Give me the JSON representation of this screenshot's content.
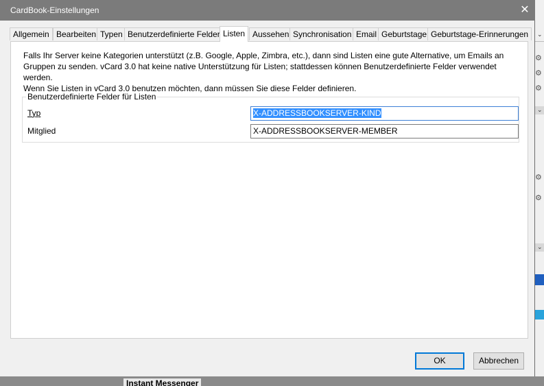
{
  "dialog": {
    "title": "CardBook-Einstellungen",
    "close_symbol": "✕"
  },
  "tabs": [
    {
      "label": "Allgemein",
      "active": false
    },
    {
      "label": "Bearbeiten",
      "active": false
    },
    {
      "label": "Typen",
      "active": false
    },
    {
      "label": "Benutzerdefinierte Felder",
      "active": false
    },
    {
      "label": "Listen",
      "active": true
    },
    {
      "label": "Aussehen",
      "active": false
    },
    {
      "label": "Synchronisation",
      "active": false
    },
    {
      "label": "Email",
      "active": false
    },
    {
      "label": "Geburtstage",
      "active": false
    },
    {
      "label": "Geburtstage-Erinnerungen",
      "active": false
    }
  ],
  "panel": {
    "description_line1": "Falls Ihr Server keine Kategorien unterstützt (z.B. Google, Apple, Zimbra, etc.), dann sind Listen eine gute Alternative, um Emails an",
    "description_line2": "Gruppen zu senden. vCard 3.0 hat keine native Unterstützung für Listen; stattdessen können Benutzerdefinierte Felder verwendet werden.",
    "description_line3": "Wenn Sie Listen in vCard 3.0 benutzen möchten, dann müssen Sie diese Felder definieren.",
    "groupbox_title": "Benutzerdefinierte Felder für Listen",
    "fields": [
      {
        "label": "Typ",
        "value": "X-ADDRESSBOOKSERVER-KIND",
        "selected": true
      },
      {
        "label": "Mitglied",
        "value": "X-ADDRESSBOOKSERVER-MEMBER",
        "selected": false
      }
    ]
  },
  "buttons": {
    "ok_label": "OK",
    "cancel_label": "Abbrechen"
  },
  "background": {
    "bottom_label": "Instant Messenger"
  },
  "colors": {
    "accent": "#0078d7",
    "selection": "#3390ff",
    "titlebar": "#7b7b7b"
  },
  "icons": {
    "close": "close-icon",
    "chevron": "chevron-down-icon",
    "gear": "gear-icon"
  }
}
